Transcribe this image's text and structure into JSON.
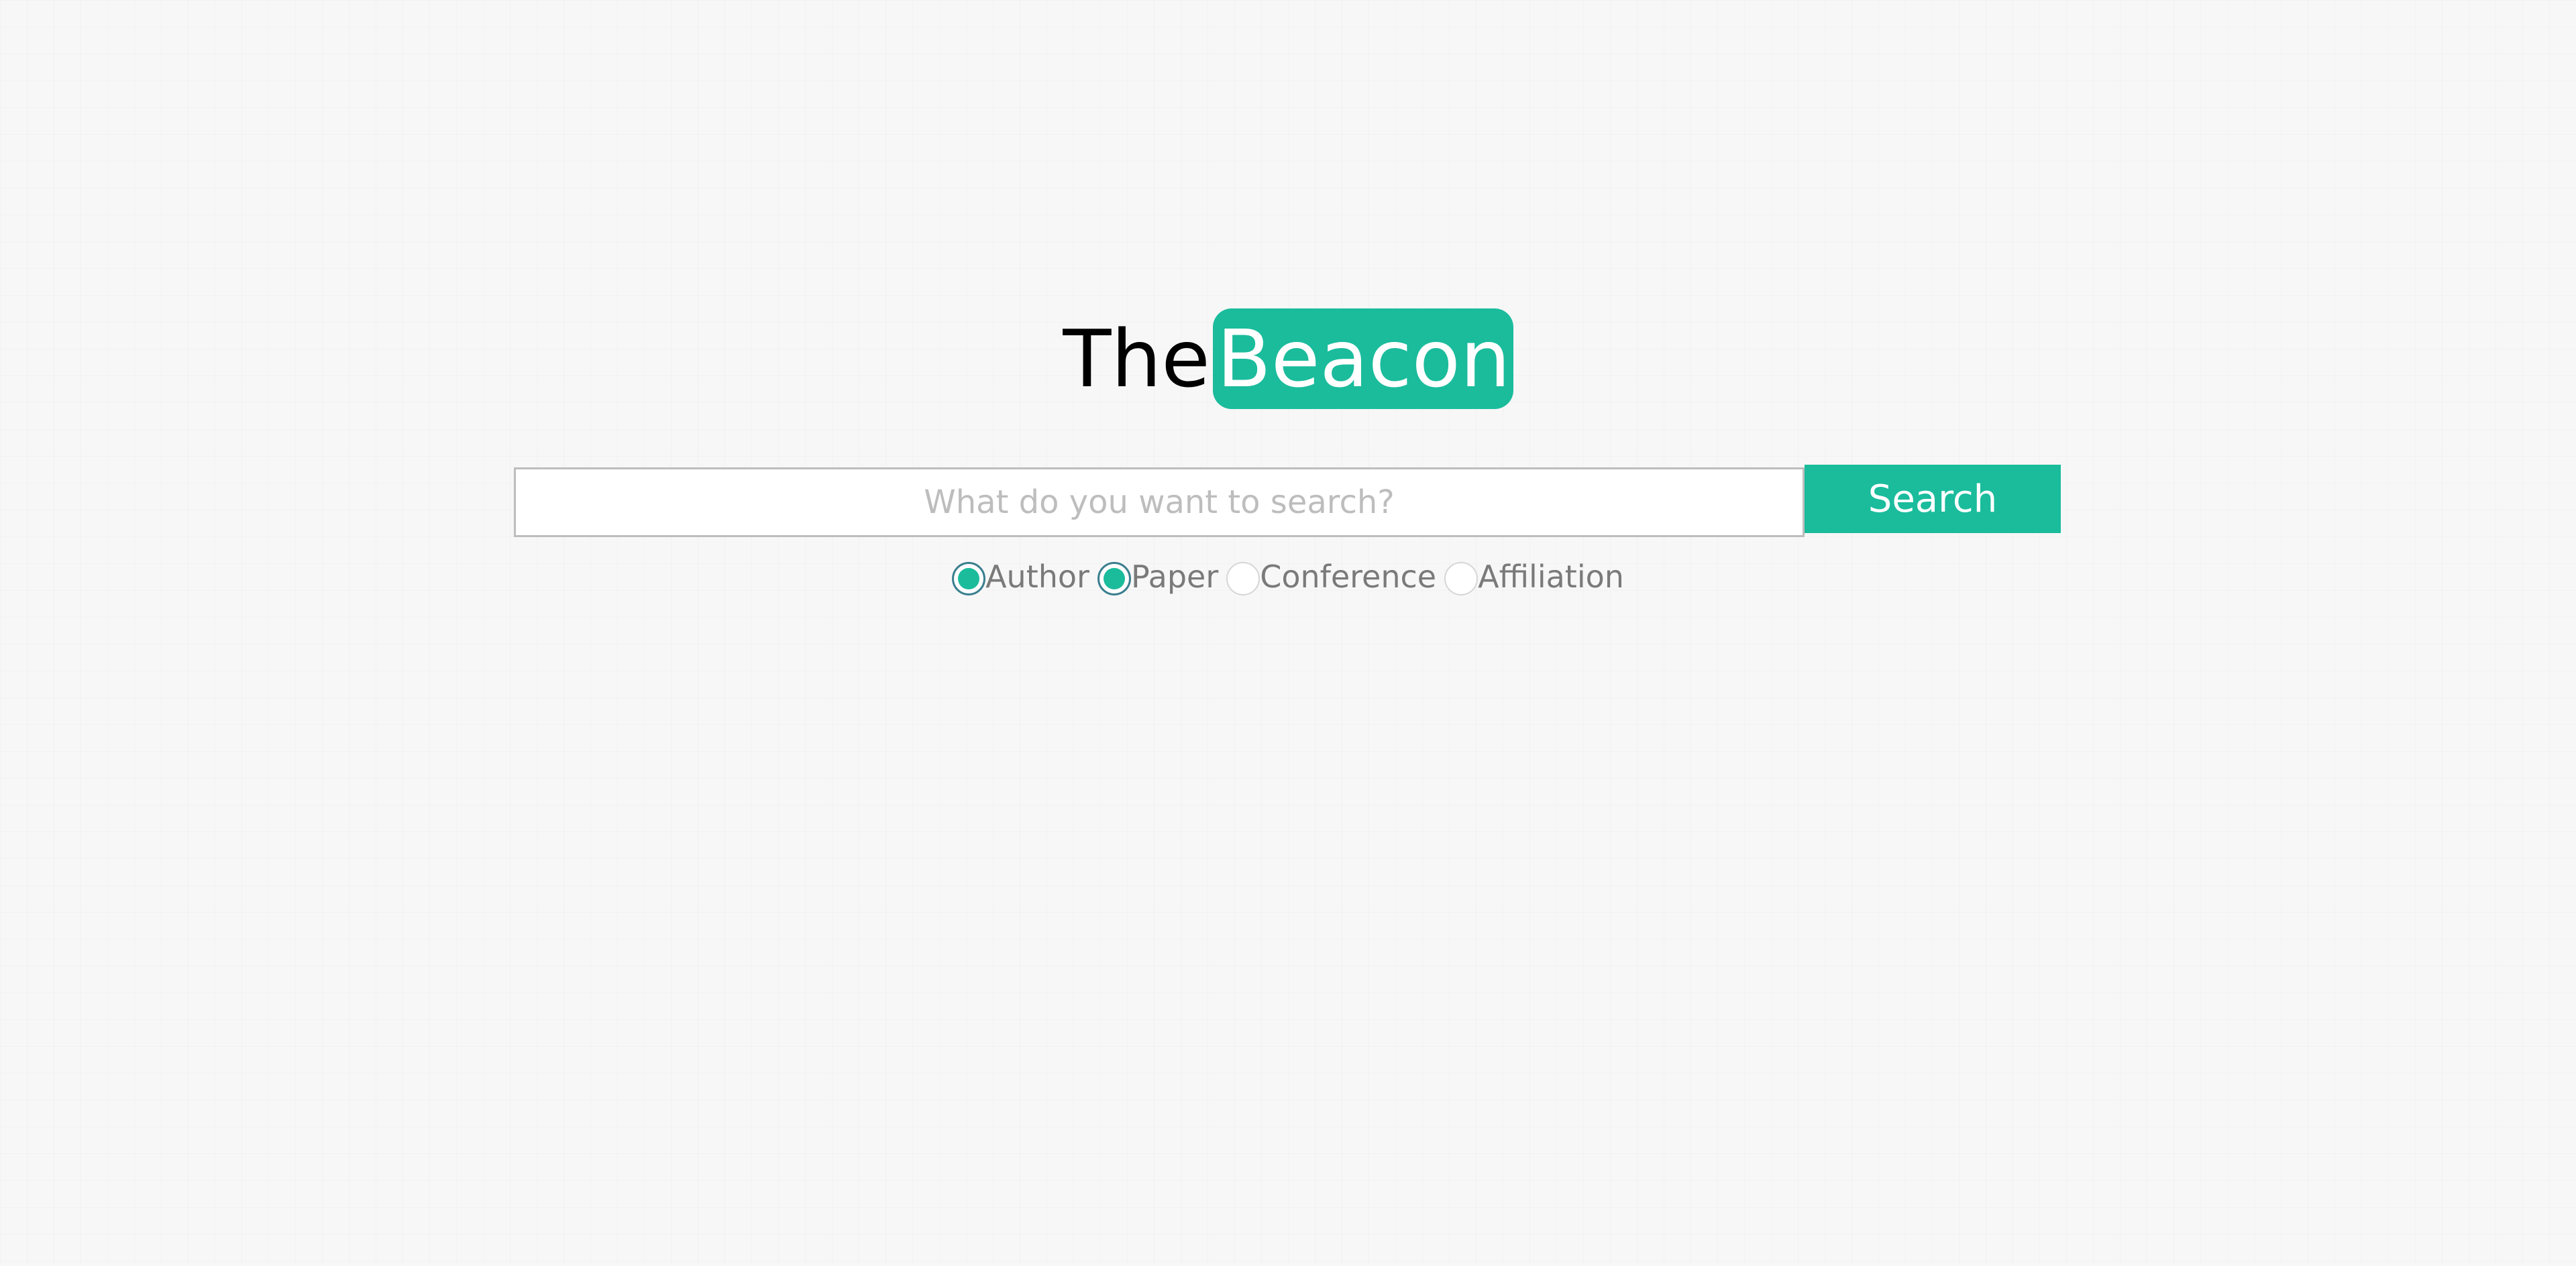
{
  "logo": {
    "prefix": "The",
    "highlight": "Beacon"
  },
  "search": {
    "placeholder": "What do you want to search?",
    "value": "",
    "button_label": "Search"
  },
  "filters": [
    {
      "label": "Author",
      "checked": true
    },
    {
      "label": "Paper",
      "checked": true
    },
    {
      "label": "Conference",
      "checked": false
    },
    {
      "label": "Affiliation",
      "checked": false
    }
  ],
  "colors": {
    "accent": "#1abc9c",
    "background": "#f7f7f7",
    "logo_text": "#000000",
    "placeholder": "#bdbdbd",
    "label": "#7a7a7a",
    "radio_checked_border": "#3b7f8f"
  }
}
